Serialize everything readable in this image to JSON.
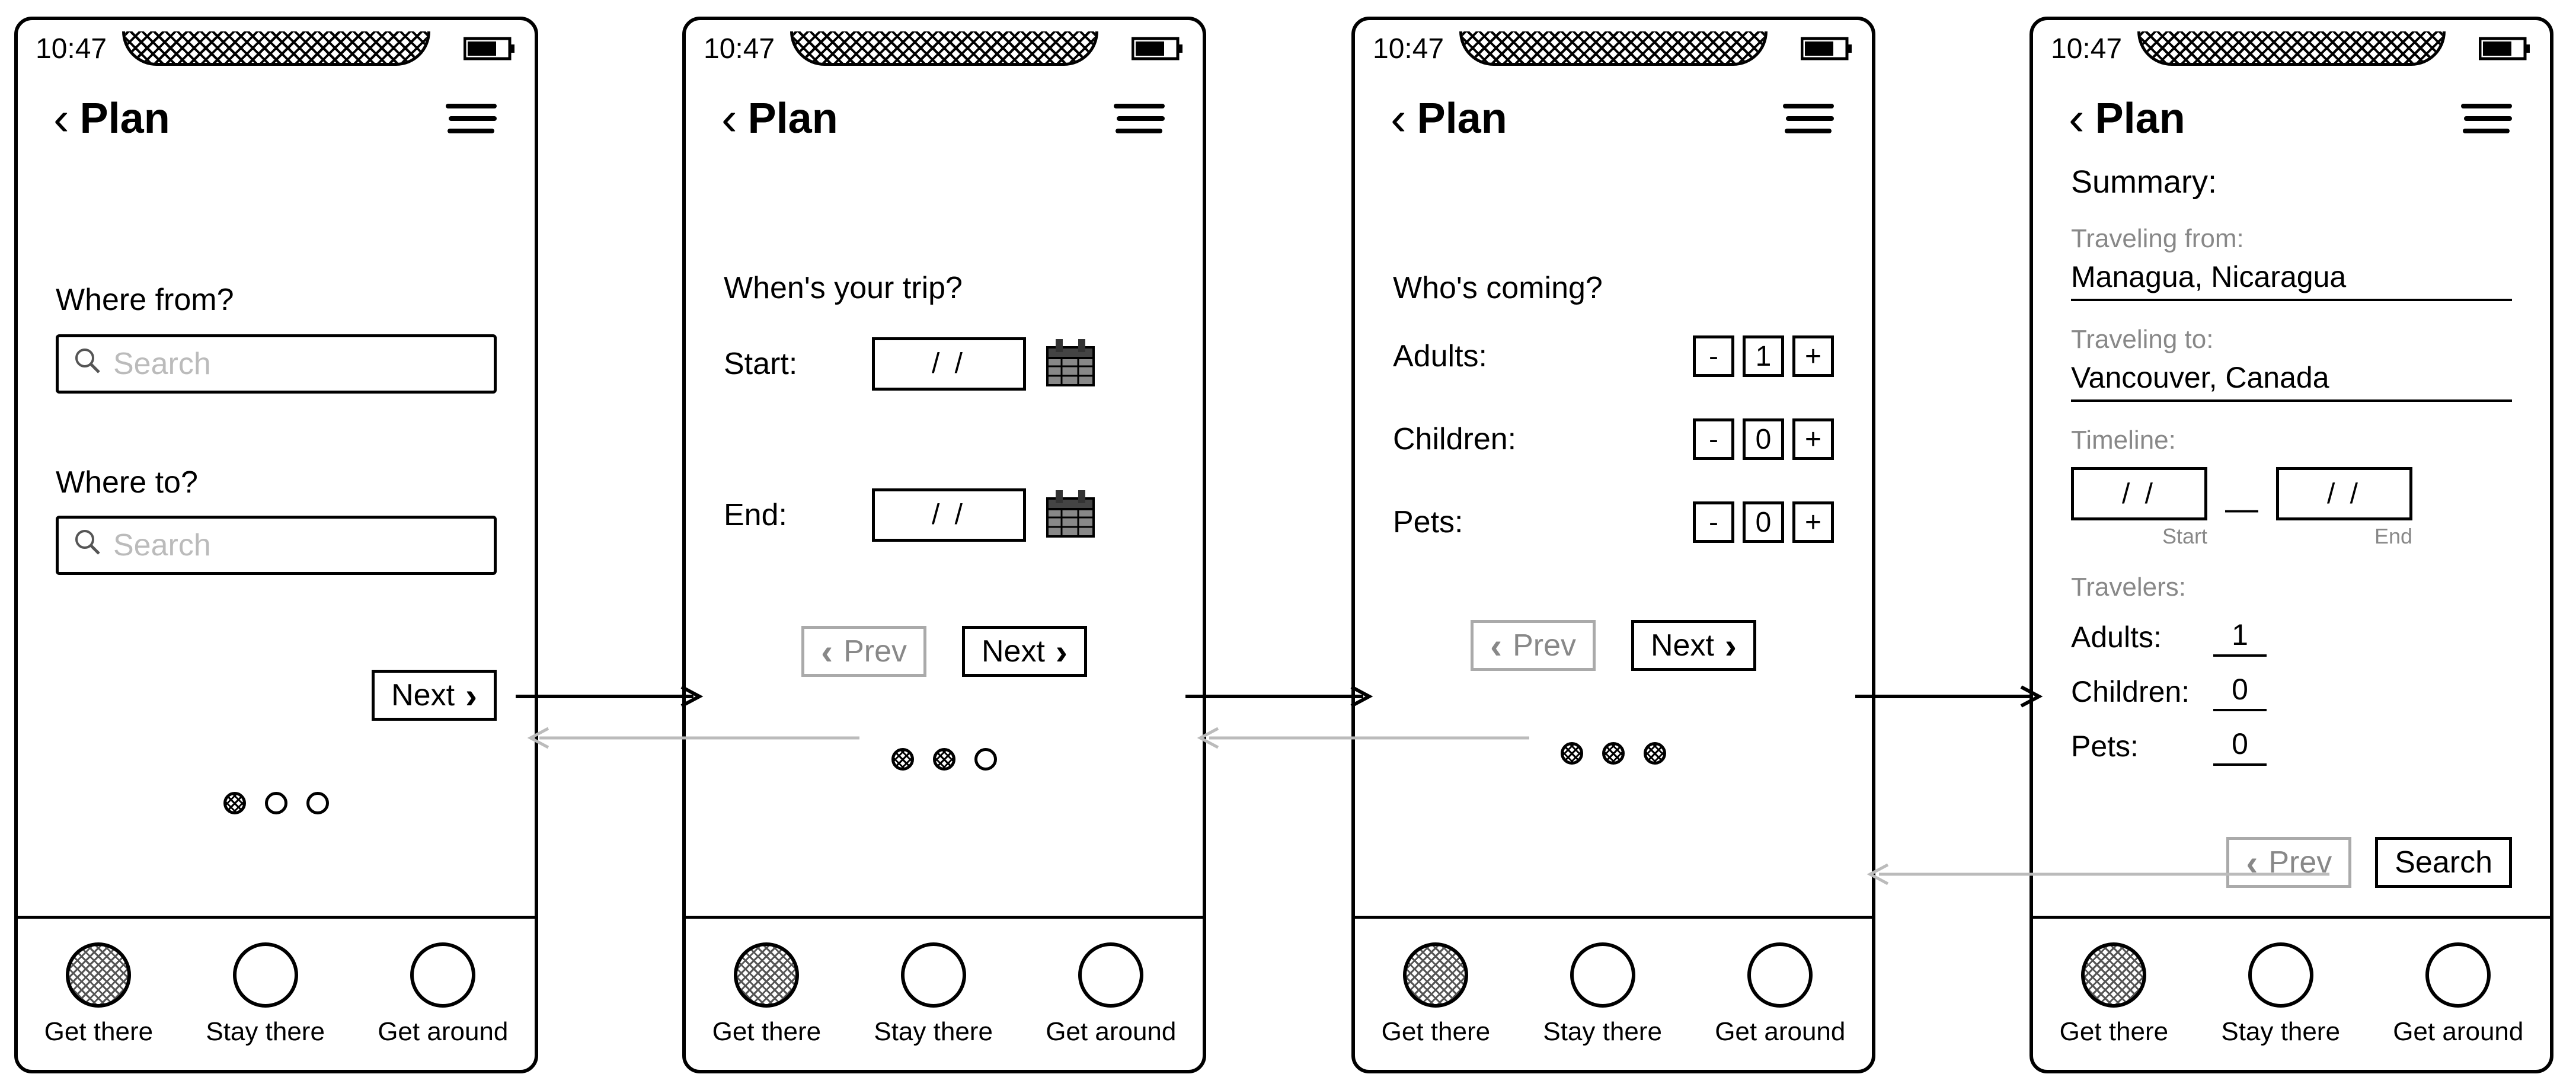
{
  "status": {
    "time": "10:47"
  },
  "header": {
    "title": "Plan"
  },
  "tabs": {
    "get_there": "Get there",
    "stay_there": "Stay there",
    "get_around": "Get around"
  },
  "screen1": {
    "where_from_label": "Where from?",
    "where_to_label": "Where to?",
    "search_placeholder": "Search",
    "next": "Next"
  },
  "screen2": {
    "heading": "When's your trip?",
    "start_label": "Start:",
    "end_label": "End:",
    "date_value": "/   /",
    "prev": "Prev",
    "next": "Next"
  },
  "screen3": {
    "heading": "Who's coming?",
    "adults_label": "Adults:",
    "children_label": "Children:",
    "pets_label": "Pets:",
    "adults_val": "1",
    "children_val": "0",
    "pets_val": "0",
    "minus": "-",
    "plus": "+",
    "prev": "Prev",
    "next": "Next"
  },
  "screen4": {
    "summary_label": "Summary:",
    "traveling_from_label": "Traveling from:",
    "traveling_from_val": "Managua, Nicaragua",
    "traveling_to_label": "Traveling to:",
    "traveling_to_val": "Vancouver, Canada",
    "timeline_label": "Timeline:",
    "date_value": "/   /",
    "start_caption": "Start",
    "end_caption": "End",
    "travelers_label": "Travelers:",
    "adults_label": "Adults:",
    "children_label": "Children:",
    "pets_label": "Pets:",
    "adults_val": "1",
    "children_val": "0",
    "pets_val": "0",
    "prev": "Prev",
    "search": "Search"
  }
}
